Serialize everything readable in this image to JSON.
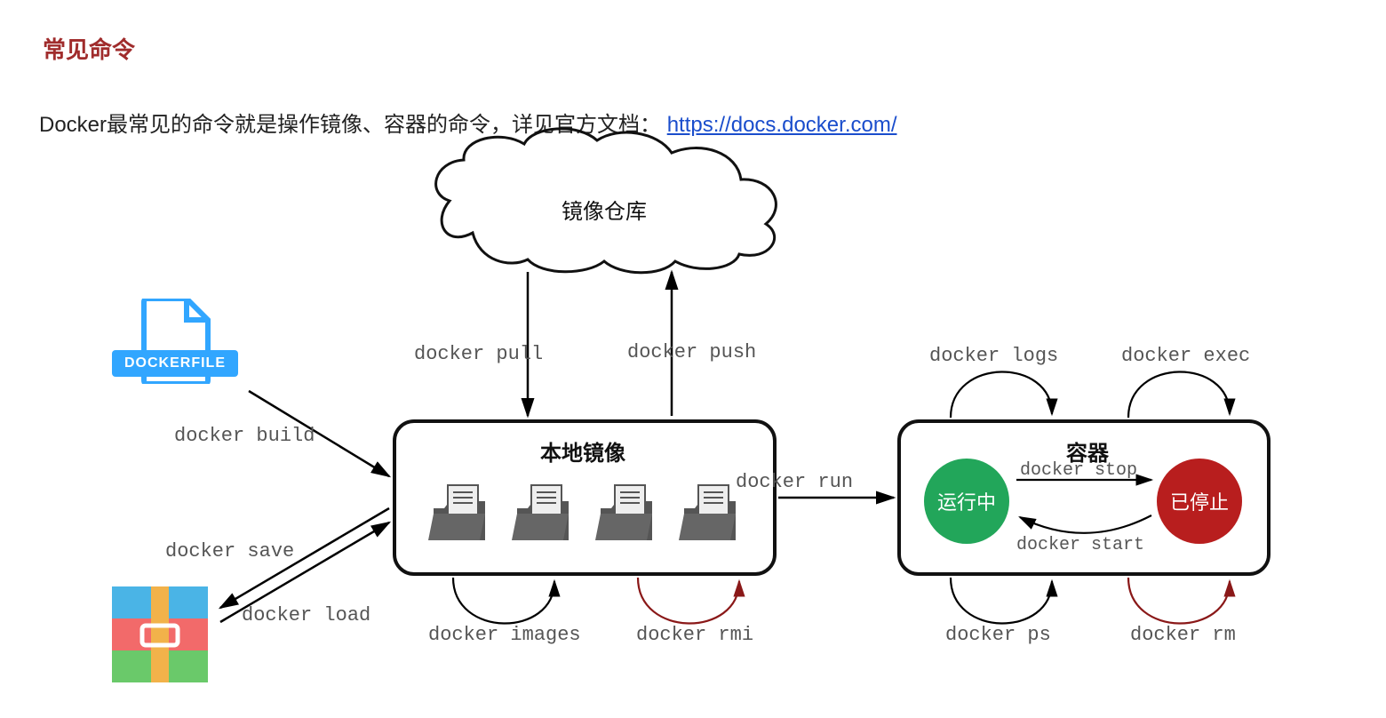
{
  "title": "常见命令",
  "subtitle_prefix": "Docker最常见的命令就是操作镜像、容器的命令，详见官方文档：",
  "docs_link": "https://docs.docker.com/",
  "nodes": {
    "repo": "镜像仓库",
    "local_images": "本地镜像",
    "container": "容器",
    "running": "运行中",
    "stopped": "已停止",
    "dockerfile_label": "DOCKERFILE"
  },
  "commands": {
    "pull": "docker pull",
    "push": "docker push",
    "build": "docker build",
    "save": "docker save",
    "load": "docker load",
    "run": "docker run",
    "images": "docker images",
    "rmi": "docker rmi",
    "logs": "docker logs",
    "exec": "docker exec",
    "ps": "docker ps",
    "rm": "docker rm",
    "stop": "docker stop",
    "start": "docker start"
  },
  "colors": {
    "title": "#a02c2c",
    "link": "#1a4dcc",
    "running": "#22a65a",
    "stopped": "#b81e1e",
    "dockerfile": "#31a6ff"
  }
}
